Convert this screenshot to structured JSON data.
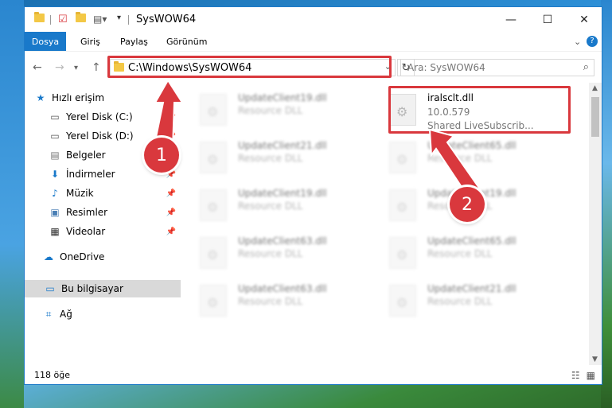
{
  "window": {
    "title": "SysWOW64"
  },
  "ribbon": {
    "tabs": [
      "Dosya",
      "Giriş",
      "Paylaş",
      "Görünüm"
    ]
  },
  "address": {
    "path": "C:\\Windows\\SysWOW64"
  },
  "search": {
    "placeholder": "Ara: SysWOW64"
  },
  "sidebar": {
    "quick_access": "Hızlı erişim",
    "items": [
      {
        "label": "Yerel Disk (C:)",
        "icon": "drive-icon"
      },
      {
        "label": "Yerel Disk (D:)",
        "icon": "drive-icon"
      },
      {
        "label": "Belgeler",
        "icon": "documents-icon"
      },
      {
        "label": "İndirmeler",
        "icon": "download-icon"
      },
      {
        "label": "Müzik",
        "icon": "music-icon"
      },
      {
        "label": "Resimler",
        "icon": "pictures-icon"
      },
      {
        "label": "Videolar",
        "icon": "videos-icon"
      }
    ],
    "onedrive": "OneDrive",
    "this_pc": "Bu bilgisayar",
    "network": "Ağ"
  },
  "files": {
    "left": [
      {
        "name": "UpdateClient19.dll",
        "sub": "Resource DLL"
      },
      {
        "name": "UpdateClient21.dll",
        "sub": "Resource DLL"
      },
      {
        "name": "UpdateClient19.dll",
        "sub": "Resource DLL"
      },
      {
        "name": "UpdateClient63.dll",
        "sub": "Resource DLL"
      },
      {
        "name": "UpdateClient63.dll",
        "sub": "Resource DLL"
      }
    ],
    "highlighted": {
      "name": "iralsclt.dll",
      "version": "10.0.579",
      "description": "Shared LiveSubscrib..."
    },
    "right": [
      {
        "name": "UpdateClient65.dll",
        "sub": "Resource DLL"
      },
      {
        "name": "UpdateClient19.dll",
        "sub": "Resource DLL"
      },
      {
        "name": "UpdateClient65.dll",
        "sub": "Resource DLL"
      },
      {
        "name": "UpdateClient21.dll",
        "sub": "Resource DLL"
      }
    ]
  },
  "status": {
    "count": "118 öğe"
  },
  "markers": {
    "one": "1",
    "two": "2"
  },
  "colors": {
    "accent": "#1979ca",
    "highlight": "#d9383d"
  }
}
